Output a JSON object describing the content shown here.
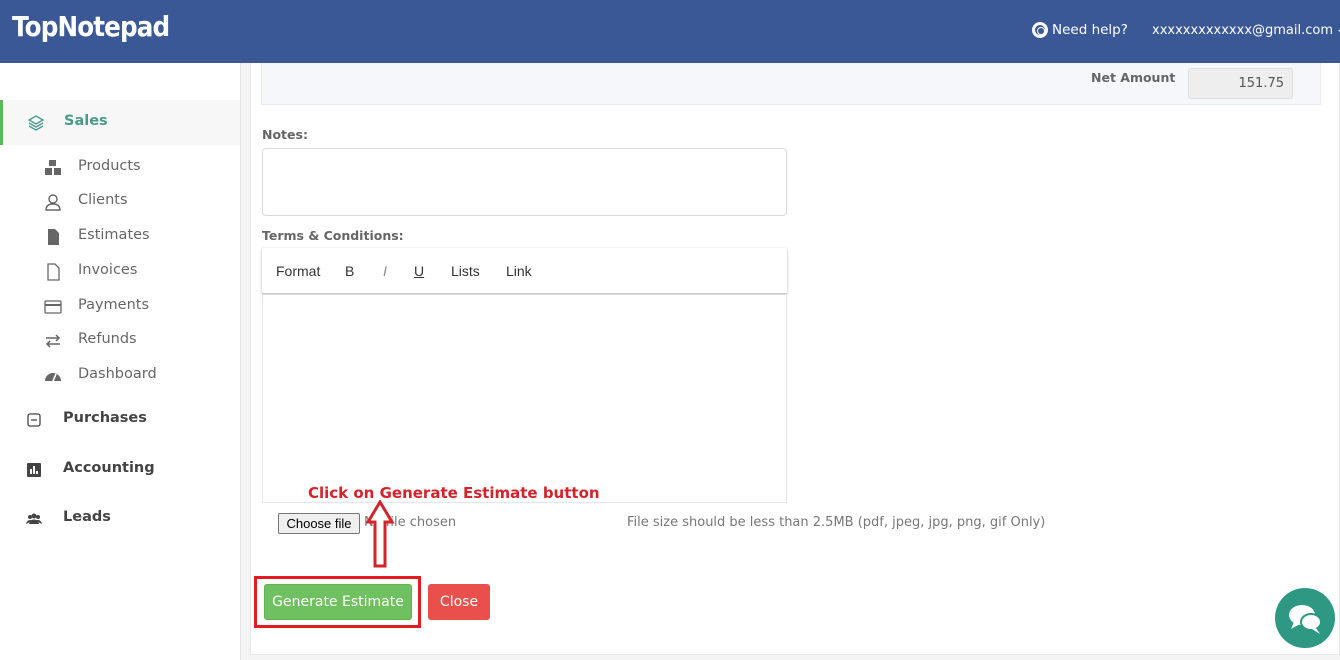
{
  "header": {
    "logo": "TopNotepad",
    "help_label": "Need help?",
    "account_email": "xxxxxxxxxxxxx@gmail.com"
  },
  "sidebar": {
    "sales": "Sales",
    "sub_items": [
      {
        "label": "Products",
        "icon": "cubes-icon"
      },
      {
        "label": "Clients",
        "icon": "user-icon"
      },
      {
        "label": "Estimates",
        "icon": "file-icon"
      },
      {
        "label": "Invoices",
        "icon": "file-outline-icon"
      },
      {
        "label": "Payments",
        "icon": "credit-card-icon"
      },
      {
        "label": "Refunds",
        "icon": "exchange-icon"
      },
      {
        "label": "Dashboard",
        "icon": "dashboard-icon"
      }
    ],
    "purchases": "Purchases",
    "accounting": "Accounting",
    "leads": "Leads"
  },
  "form": {
    "net_amount_label": "Net Amount",
    "net_amount_value": "151.75",
    "notes_label": "Notes:",
    "terms_label": "Terms & Conditions:",
    "toolbar": {
      "format": "Format",
      "bold": "B",
      "italic": "I",
      "underline": "U",
      "lists": "Lists",
      "link": "Link"
    },
    "choose_file": "Choose file",
    "file_status": "No file chosen",
    "file_hint": "File size should be less than 2.5MB (pdf, jpeg, jpg, png, gif Only)",
    "generate_button": "Generate Estimate",
    "close_button": "Close"
  },
  "annotation": {
    "text": "Click on Generate Estimate button"
  },
  "colors": {
    "header": "#3b5896",
    "accent_green": "#6fc05e",
    "danger": "#e9504c",
    "annotation_red": "#d4232a",
    "chat": "#2f9882"
  }
}
